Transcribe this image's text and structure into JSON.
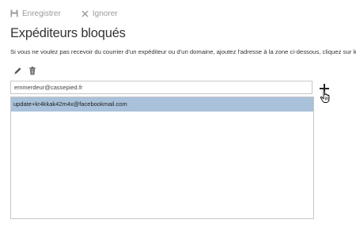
{
  "toolbar": {
    "save_label": "Enregistrer",
    "ignore_label": "Ignorer"
  },
  "page": {
    "title": "Expéditeurs bloqués",
    "description": "Si vous ne voulez pas recevoir du courrier d'un expéditeur ou d'un domaine, ajoutez l'adresse à la zone ci-dessous, cliquez sur le sign"
  },
  "actions": {
    "edit_icon": "pencil-icon",
    "delete_icon": "trash-icon",
    "add_icon": "plus-icon"
  },
  "input": {
    "value": "emmerdeur@cassepied.fr"
  },
  "blocked_list": {
    "items": [
      {
        "address": "update+kr4kkak42m4x@facebookmail.com",
        "selected": true
      }
    ]
  },
  "colors": {
    "selection": "#a9c1da",
    "toolbar_text": "#9a9a9a",
    "border": "#c8c8c8"
  }
}
